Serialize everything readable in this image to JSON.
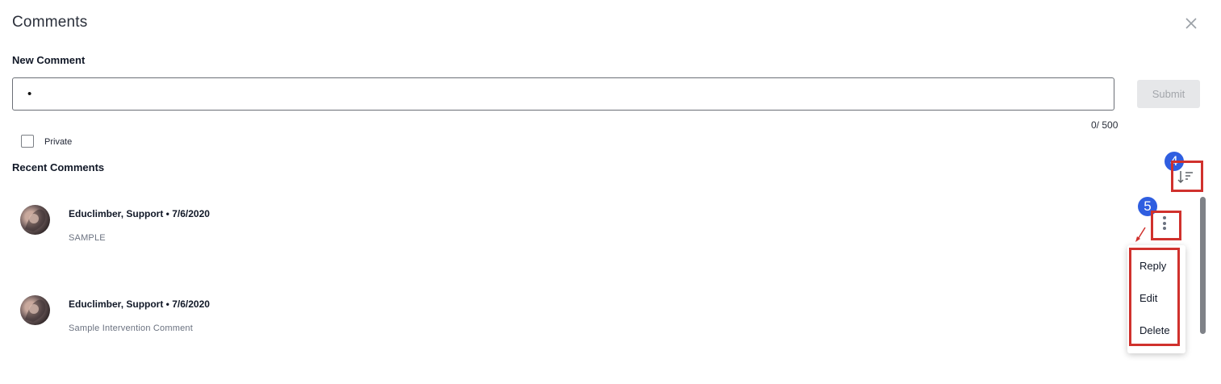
{
  "dialog": {
    "title": "Comments",
    "close_icon": "close-icon"
  },
  "new_comment": {
    "label": "New Comment",
    "input_value": "•",
    "submit_label": "Submit",
    "counter": "0/ 500",
    "private_label": "Private",
    "private_checked": false
  },
  "recent": {
    "label": "Recent Comments",
    "sort_icon": "sort-descending-icon",
    "comments": [
      {
        "meta": "Educlimber, Support • 7/6/2020",
        "text": "SAMPLE"
      },
      {
        "meta": "Educlimber, Support • 7/6/2020",
        "text": "Sample Intervention Comment"
      }
    ]
  },
  "menu": {
    "items": [
      "Reply",
      "Edit",
      "Delete"
    ]
  },
  "annotations": {
    "badge_sort": "4",
    "badge_kebab": "5",
    "highlight_color": "#d0312d",
    "badge_color": "#2f5ee0"
  }
}
